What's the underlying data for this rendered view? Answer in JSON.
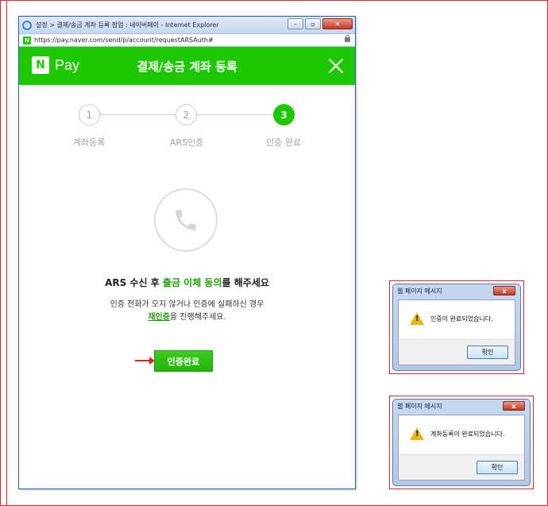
{
  "browser": {
    "title": "설정 > 결제/송금 계좌 등록 팝업 : 네이버페이 - Internet Explorer",
    "url": "https://pay.naver.com/send/p/account/requestARSAuth#",
    "controls": {
      "minimize": "–",
      "maximize": "▫",
      "close": "✕"
    }
  },
  "header": {
    "logo_letter": "N",
    "logo_text": "Pay",
    "title": "결제/송금 계좌 등록"
  },
  "steps": [
    {
      "number": "1",
      "label": "계좌등록"
    },
    {
      "number": "2",
      "label": "ARS인증"
    },
    {
      "number": "3",
      "label": "인증 완료"
    }
  ],
  "active_step": 3,
  "message": {
    "main_prefix": "ARS 수신 후 ",
    "main_highlight": "출금 이체 동의",
    "main_suffix": "를 해주세요",
    "sub_line1": "인증 전화가 오지 않거나 인증에 실패하신 경우",
    "sub_link": "재인증",
    "sub_line2_suffix": "을 진행해주세요."
  },
  "button": {
    "label": "인증완료"
  },
  "dialogs": [
    {
      "title": "웹 페이지 메시지",
      "message": "인증이 완료되었습니다.",
      "ok_label": "확인",
      "close": "x"
    },
    {
      "title": "웹 페이지 메시지",
      "message": "계좌등록이 완료되었습니다.",
      "ok_label": "확인",
      "close": "x"
    }
  ],
  "colors": {
    "naver_green": "#1ec800",
    "highlight_green": "#1a9f00",
    "annotation_red": "#d9272e"
  }
}
